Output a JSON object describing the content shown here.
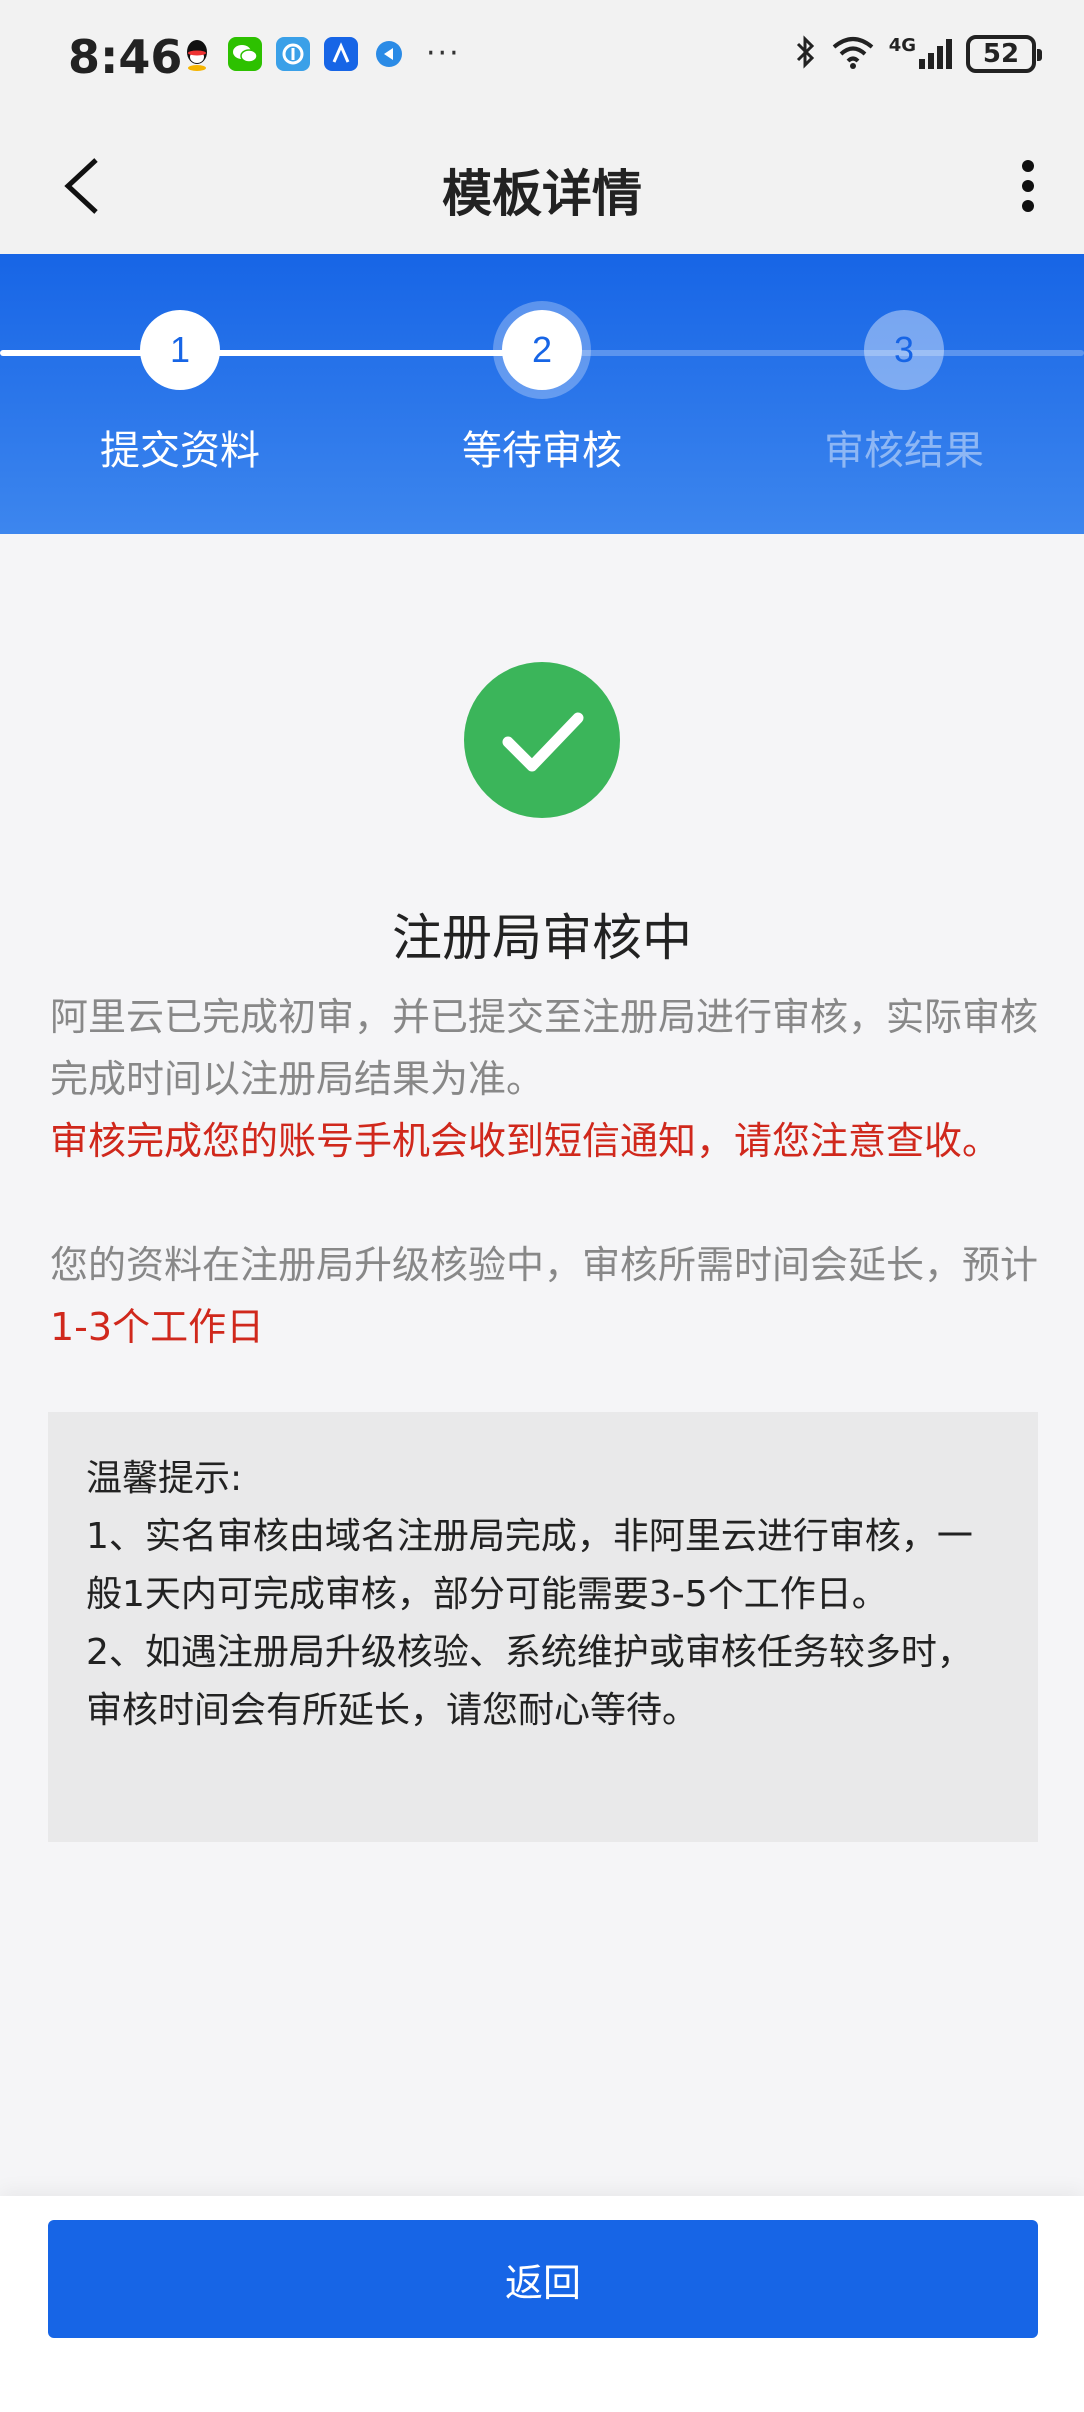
{
  "status_bar": {
    "time": "8:46",
    "network": "4G",
    "battery": "52",
    "more": "···"
  },
  "nav": {
    "title": "模板详情"
  },
  "steps": [
    {
      "number": "1",
      "label": "提交资料",
      "state": "done"
    },
    {
      "number": "2",
      "label": "等待审核",
      "state": "active"
    },
    {
      "number": "3",
      "label": "审核结果",
      "state": "todo"
    }
  ],
  "result": {
    "title": "注册局审核中",
    "desc1": "阿里云已完成初审，并已提交至注册局进行审核，实际审核完成时间以注册局结果为准。",
    "desc2": "审核完成您的账号手机会收到短信通知，请您注意查收。",
    "desc3_prefix": "您的资料在注册局升级核验中，审核所需时间会延长，预计",
    "desc3_highlight": "1-3个工作日"
  },
  "tips": {
    "title": "温馨提示:",
    "line1": "1、实名审核由域名注册局完成，非阿里云进行审核，一般1天内可完成审核，部分可能需要3-5个工作日。",
    "line2": "2、如遇注册局升级核验、系统维护或审核任务较多时，审核时间会有所延长，请您耐心等待。"
  },
  "bottom": {
    "back_label": "返回"
  },
  "colors": {
    "primary": "#1765e6",
    "success": "#3bb55a",
    "warning_text": "#d0281c",
    "muted_text": "#888888"
  }
}
